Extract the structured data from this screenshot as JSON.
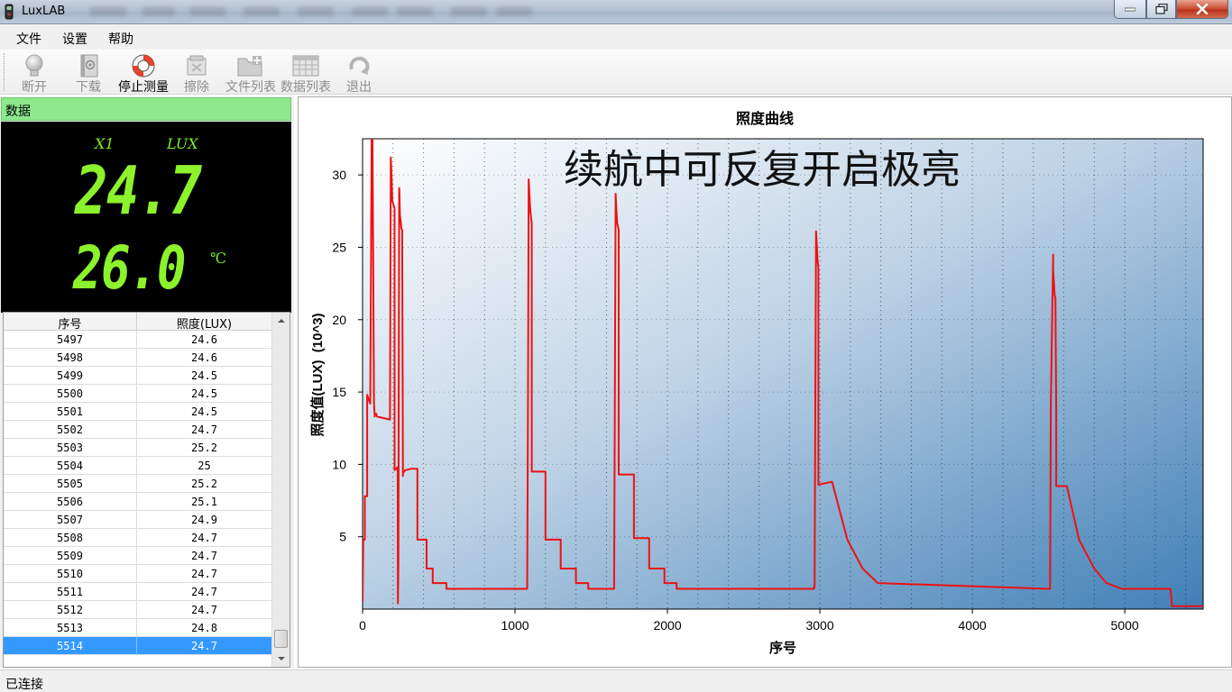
{
  "window": {
    "title": "LuxLAB"
  },
  "menu": [
    {
      "label": "文件"
    },
    {
      "label": "设置"
    },
    {
      "label": "帮助"
    }
  ],
  "toolbar": [
    {
      "label": "断开",
      "icon": "bulb-icon",
      "enabled": false
    },
    {
      "label": "下载",
      "icon": "download-book-icon",
      "enabled": false
    },
    {
      "label": "停止测量",
      "icon": "lifebuoy-icon",
      "enabled": true
    },
    {
      "label": "擦除",
      "icon": "erase-icon",
      "enabled": false
    },
    {
      "label": "文件列表",
      "icon": "folder-add-icon",
      "enabled": false
    },
    {
      "label": "数据列表",
      "icon": "calendar-grid-icon",
      "enabled": false
    },
    {
      "label": "退出",
      "icon": "exit-arrow-icon",
      "enabled": false
    }
  ],
  "left_panel": {
    "header": "数据",
    "display": {
      "multiplier": "X1",
      "unit": "LUX",
      "lux_value": "24.7",
      "temperature_value": "26.0",
      "temperature_unit": "℃"
    },
    "table": {
      "columns": [
        "序号",
        "照度(LUX)"
      ],
      "rows": [
        [
          "5497",
          "24.6"
        ],
        [
          "5498",
          "24.6"
        ],
        [
          "5499",
          "24.5"
        ],
        [
          "5500",
          "24.5"
        ],
        [
          "5501",
          "24.5"
        ],
        [
          "5502",
          "24.7"
        ],
        [
          "5503",
          "25.2"
        ],
        [
          "5504",
          "25"
        ],
        [
          "5505",
          "25.2"
        ],
        [
          "5506",
          "25.1"
        ],
        [
          "5507",
          "24.9"
        ],
        [
          "5508",
          "24.7"
        ],
        [
          "5509",
          "24.7"
        ],
        [
          "5510",
          "24.7"
        ],
        [
          "5511",
          "24.7"
        ],
        [
          "5512",
          "24.7"
        ],
        [
          "5513",
          "24.8"
        ],
        [
          "5514",
          "24.7"
        ]
      ],
      "selected_row": 17
    }
  },
  "status": {
    "text": "已连接"
  },
  "colors": {
    "line": "#ee1111",
    "lcd": "#8cf22c",
    "header_green": "#8ee88e",
    "selection": "#3399ff"
  },
  "chart_data": {
    "type": "line",
    "title": "照度曲线",
    "annotation": "续航中可反复开启极亮",
    "xlabel": "序号",
    "ylabel": "照度值(LUX)  (10^3)",
    "xlim": [
      0,
      5514
    ],
    "ylim": [
      0,
      32.5
    ],
    "xticks": [
      0,
      1000,
      2000,
      3000,
      4000,
      5000
    ],
    "yticks": [
      5,
      10,
      15,
      20,
      25,
      30
    ],
    "grid": true,
    "series": [
      {
        "x": [
          0,
          5,
          15,
          15,
          30,
          30,
          50,
          60,
          65,
          75,
          80,
          80,
          90,
          95,
          180,
          185,
          190,
          195,
          210,
          210,
          230,
          232,
          235,
          240,
          242,
          245,
          250,
          255,
          260,
          265,
          265,
          280,
          320,
          360,
          360,
          420,
          420,
          460,
          460,
          550,
          550,
          650,
          650,
          1080,
          1085,
          1090,
          1095,
          1100,
          1105,
          1110,
          1110,
          1200,
          1200,
          1300,
          1300,
          1400,
          1400,
          1480,
          1480,
          1650,
          1655,
          1660,
          1665,
          1670,
          1680,
          1680,
          1780,
          1780,
          1880,
          1880,
          1980,
          1980,
          2060,
          2060,
          2400,
          2960,
          2960,
          2965,
          2970,
          2975,
          2980,
          2985,
          2990,
          2990,
          3080,
          3080,
          3180,
          3180,
          3280,
          3280,
          3380,
          3380,
          4500,
          4505,
          4510,
          4515,
          4530,
          4530,
          4540,
          4545,
          4550,
          4550,
          4620,
          4620,
          4700,
          4700,
          4800,
          4800,
          4880,
          4880,
          4980,
          4980,
          5300,
          5310,
          5310,
          5514
        ],
        "y": [
          0.5,
          4.8,
          4.8,
          7.8,
          7.8,
          14.8,
          14.2,
          32.5,
          32.5,
          14.2,
          13.3,
          13.5,
          13.5,
          13.3,
          13.1,
          31.2,
          30,
          28.2,
          27.7,
          9.6,
          9.8,
          0.4,
          3,
          29.1,
          28.7,
          27.2,
          26.8,
          26.3,
          26.2,
          9.2,
          9.4,
          9.6,
          9.7,
          9.7,
          4.8,
          4.8,
          2.8,
          2.8,
          1.8,
          1.8,
          1.4,
          1.4,
          1.4,
          1.4,
          14,
          29.7,
          28.5,
          27.6,
          27.1,
          26.6,
          9.5,
          9.5,
          4.8,
          4.8,
          2.8,
          2.8,
          1.8,
          1.8,
          1.4,
          1.4,
          14,
          28.7,
          27.6,
          26.7,
          26.2,
          9.3,
          9.3,
          4.9,
          4.9,
          2.8,
          2.8,
          1.8,
          1.8,
          1.4,
          1.4,
          1.4,
          1.5,
          1.5,
          14,
          26.1,
          25.1,
          24.1,
          23.6,
          8.6,
          8.8,
          8.8,
          4.8,
          4.8,
          2.8,
          2.8,
          1.8,
          1.8,
          1.4,
          1.4,
          1.4,
          14,
          24.5,
          23.4,
          21.7,
          21.5,
          13.5,
          8.5,
          8.5,
          8.5,
          4.8,
          4.8,
          2.8,
          2.8,
          1.8,
          1.8,
          1.4,
          1.4,
          1.4,
          0.2,
          0.2,
          0.2
        ]
      }
    ]
  }
}
